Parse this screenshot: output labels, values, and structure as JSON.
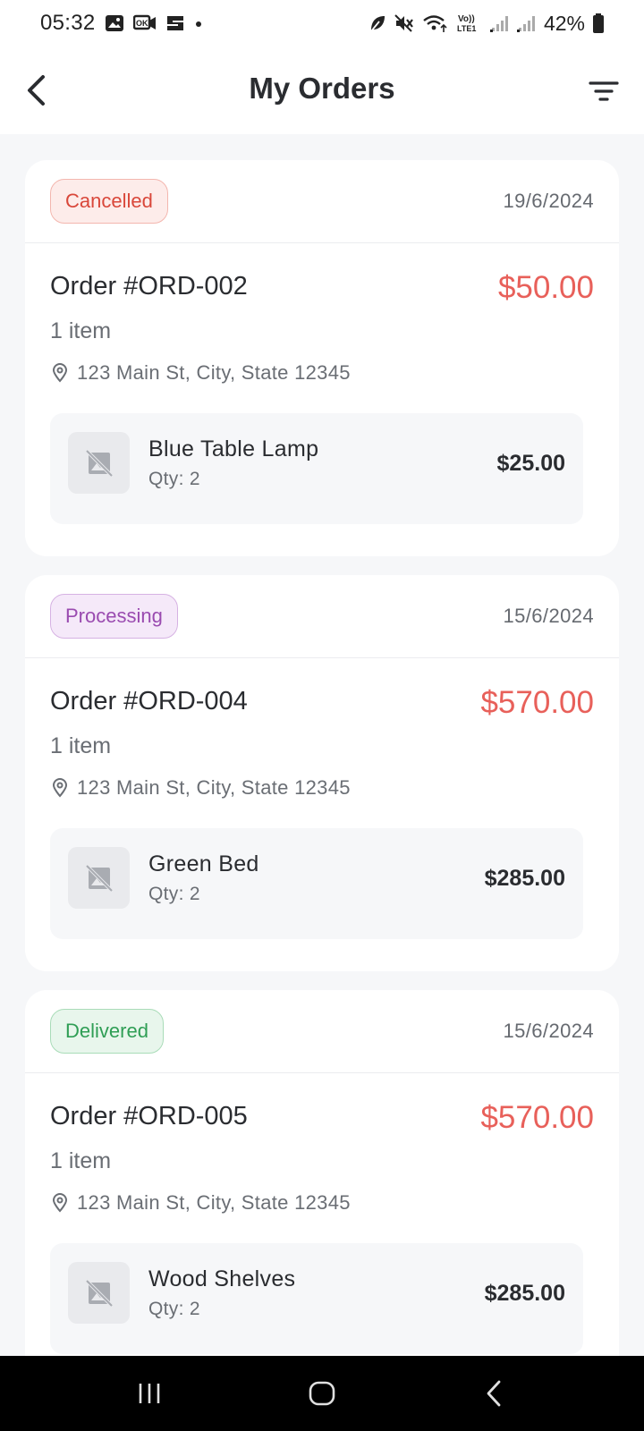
{
  "status_bar": {
    "time": "05:32",
    "battery": "42%",
    "left_icons": [
      "gallery-icon",
      "cast-icon",
      "app-icon",
      "dot-icon"
    ],
    "right_icons": [
      "leaf-icon",
      "mute-icon",
      "wifi-icon",
      "volte-icon",
      "signal-icon",
      "signal-icon",
      "battery-icon"
    ],
    "volte_label": "Vo)) LTE1"
  },
  "header": {
    "title": "My Orders",
    "back_icon": "chevron-left-icon",
    "filter_icon": "filter-icon"
  },
  "orders": [
    {
      "status": "Cancelled",
      "date": "19/6/2024",
      "order_number": "Order #ORD-002",
      "total": "$50.00",
      "item_count": "1 item",
      "address": "123 Main St, City, State 12345",
      "item": {
        "name": "Blue Table Lamp",
        "qty": "Qty: 2",
        "price": "$25.00"
      }
    },
    {
      "status": "Processing",
      "date": "15/6/2024",
      "order_number": "Order #ORD-004",
      "total": "$570.00",
      "item_count": "1 item",
      "address": "123 Main St, City, State 12345",
      "item": {
        "name": "Green Bed",
        "qty": "Qty: 2",
        "price": "$285.00"
      }
    },
    {
      "status": "Delivered",
      "date": "15/6/2024",
      "order_number": "Order #ORD-005",
      "total": "$570.00",
      "item_count": "1 item",
      "address": "123 Main St, City, State 12345",
      "item": {
        "name": "Wood Shelves",
        "qty": "Qty: 2",
        "price": "$285.00"
      }
    }
  ],
  "colors": {
    "total": "#e8605a",
    "cancelled": "#d9473a",
    "processing": "#9a4bb0",
    "delivered": "#2f9e55"
  },
  "nav_bar": {
    "icons": [
      "recents-icon",
      "home-icon",
      "back-icon"
    ]
  }
}
